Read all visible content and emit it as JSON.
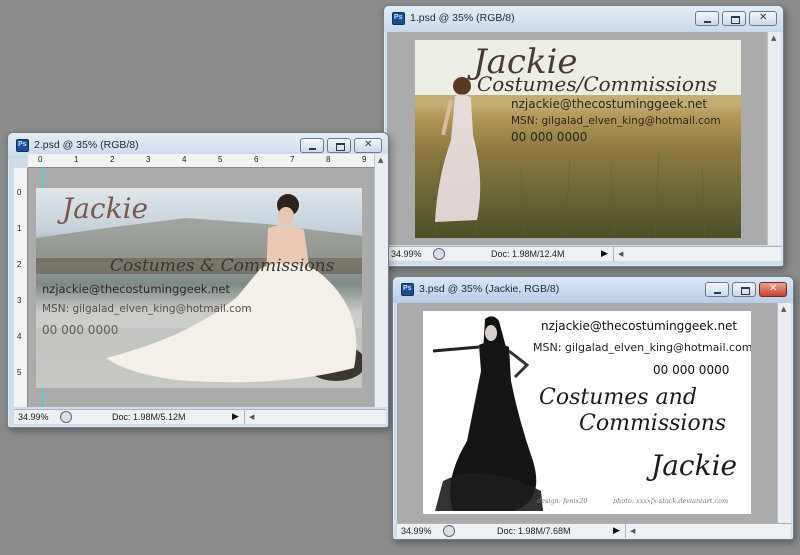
{
  "windows": {
    "doc1": {
      "title": "1.psd @ 35% (RGB/8)",
      "zoom": "34.99%",
      "doc_info": "Doc: 1.98M/12.4M",
      "card": {
        "name": "Jackie",
        "tagline": "Costumes/Commissions",
        "email": "nzjackie@thecostuminggeek.net",
        "msn": "MSN: gilgalad_elven_king@hotmail.com",
        "phone": "00 000 0000"
      }
    },
    "doc2": {
      "title": "2.psd @ 35% (RGB/8)",
      "zoom": "34.99%",
      "doc_info": "Doc: 1.98M/5.12M",
      "ruler_h": [
        "0",
        "1",
        "2",
        "3",
        "4",
        "5",
        "6",
        "7",
        "8",
        "9"
      ],
      "ruler_v": [
        "0",
        "1",
        "2",
        "3",
        "4",
        "5"
      ],
      "card": {
        "name": "Jackie",
        "tagline": "Costumes & Commissions",
        "email": "nzjackie@thecostuminggeek.net",
        "msn": "MSN: gilgalad_elven_king@hotmail.com",
        "phone": "00 000 0000"
      }
    },
    "doc3": {
      "title": "3.psd @ 35% (Jackie, RGB/8)",
      "zoom": "34.99%",
      "doc_info": "Doc: 1.98M/7.68M",
      "card": {
        "email": "nzjackie@thecostuminggeek.net",
        "msn": "MSN: gilgalad_elven_king@hotmail.com",
        "phone": "00 000 0000",
        "tagline_1": "Costumes and",
        "tagline_2": "Commissions",
        "name": "Jackie",
        "credit_left": "design: fenix20",
        "credit_right": "photo: xxxxfx-stock.deviantart.com"
      }
    }
  },
  "colors": {
    "desktop": "#8c8c8c",
    "canvas_gray": "#ababab",
    "close_red": "#c6422b"
  }
}
